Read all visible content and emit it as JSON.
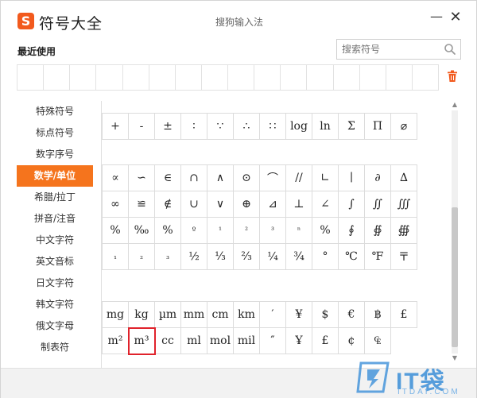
{
  "titlebar": {
    "logo_glyph": "S",
    "title": "符号大全",
    "ime_name": "搜狗输入法",
    "minimize": "—",
    "close": "✕"
  },
  "recent": {
    "label": "最近使用",
    "cells": 16
  },
  "search": {
    "placeholder": "搜索符号"
  },
  "sidebar": {
    "items": [
      {
        "label": "特殊符号",
        "active": false
      },
      {
        "label": "标点符号",
        "active": false
      },
      {
        "label": "数字序号",
        "active": false
      },
      {
        "label": "数学/单位",
        "active": true
      },
      {
        "label": "希腊/拉丁",
        "active": false
      },
      {
        "label": "拼音/注音",
        "active": false
      },
      {
        "label": "中文字符",
        "active": false
      },
      {
        "label": "英文音标",
        "active": false
      },
      {
        "label": "日文字符",
        "active": false
      },
      {
        "label": "韩文字符",
        "active": false
      },
      {
        "label": "俄文字母",
        "active": false
      },
      {
        "label": "制表符",
        "active": false
      }
    ]
  },
  "groups": {
    "ops": [
      "+",
      "-",
      "±",
      "∶",
      "∵",
      "∴",
      "∷",
      "log",
      "ln",
      "Σ",
      "Π",
      "⌀"
    ],
    "math": [
      "∝",
      "∽",
      "∈",
      "∩",
      "∧",
      "⊙",
      "⌒",
      "//",
      "∟",
      "∣",
      "∂",
      "∆",
      "∞",
      "≌",
      "∉",
      "∪",
      "∨",
      "⊕",
      "⊿",
      "⊥",
      "∠",
      "∫",
      "∬",
      "∭",
      "%",
      "‰",
      "%",
      "º",
      "¹",
      "²",
      "³",
      "ⁿ",
      "%",
      "∮",
      "∯",
      "∰",
      "₁",
      "₂",
      "₃",
      "½",
      "⅓",
      "⅔",
      "¼",
      "¾",
      "°",
      "℃",
      "℉",
      "〒"
    ],
    "units": [
      "mg",
      "kg",
      "µm",
      "mm",
      "cm",
      "km",
      "′",
      "¥",
      "$",
      "€",
      "฿",
      "£",
      "m²",
      "m³",
      "cc",
      "ml",
      "mol",
      "mil",
      "″",
      "Ұ",
      "£",
      "¢",
      "₠"
    ],
    "selected_unit": "m³"
  },
  "watermark": {
    "brand": "IT袋",
    "domain": "ITDAI.COM"
  },
  "colors": {
    "accent": "#f5741d",
    "selection": "#e0222b",
    "logo": "#f25a1d"
  }
}
